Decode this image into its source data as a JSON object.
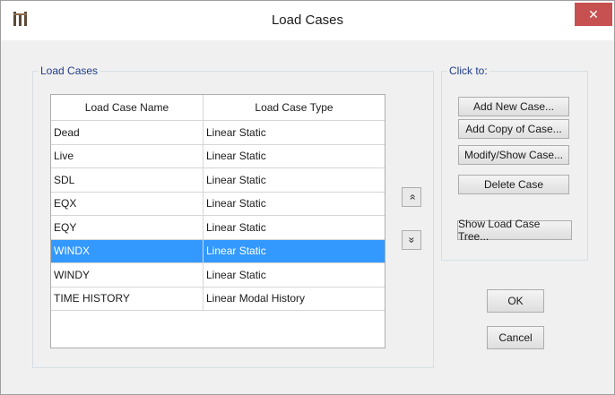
{
  "window": {
    "title": "Load Cases",
    "close_glyph": "✕"
  },
  "load_cases_group": {
    "label": "Load Cases",
    "columns": [
      "Load Case Name",
      "Load Case Type"
    ],
    "rows": [
      {
        "name": "Dead",
        "type": "Linear Static"
      },
      {
        "name": "Live",
        "type": "Linear Static"
      },
      {
        "name": "SDL",
        "type": "Linear Static"
      },
      {
        "name": "EQX",
        "type": "Linear Static"
      },
      {
        "name": "EQY",
        "type": "Linear Static"
      },
      {
        "name": "WINDX",
        "type": "Linear Static",
        "selected": true
      },
      {
        "name": "WINDY",
        "type": "Linear Static"
      },
      {
        "name": "TIME HISTORY",
        "type": "Linear Modal History"
      }
    ],
    "move_up_glyph": "»",
    "move_down_glyph": "»"
  },
  "click_to_group": {
    "label": "Click to:",
    "buttons": {
      "add_new": "Add New Case...",
      "add_copy": "Add Copy of Case...",
      "modify_show": "Modify/Show Case...",
      "delete": "Delete Case",
      "show_tree": "Show Load Case Tree..."
    }
  },
  "dialog_buttons": {
    "ok": "OK",
    "cancel": "Cancel"
  },
  "colors": {
    "selection": "#3399ff",
    "group_label": "#1f3c88",
    "close_button": "#c75050"
  },
  "icons": {
    "app": "app-logo-icon",
    "close": "close-icon",
    "up": "move-up-icon",
    "down": "move-down-icon"
  }
}
